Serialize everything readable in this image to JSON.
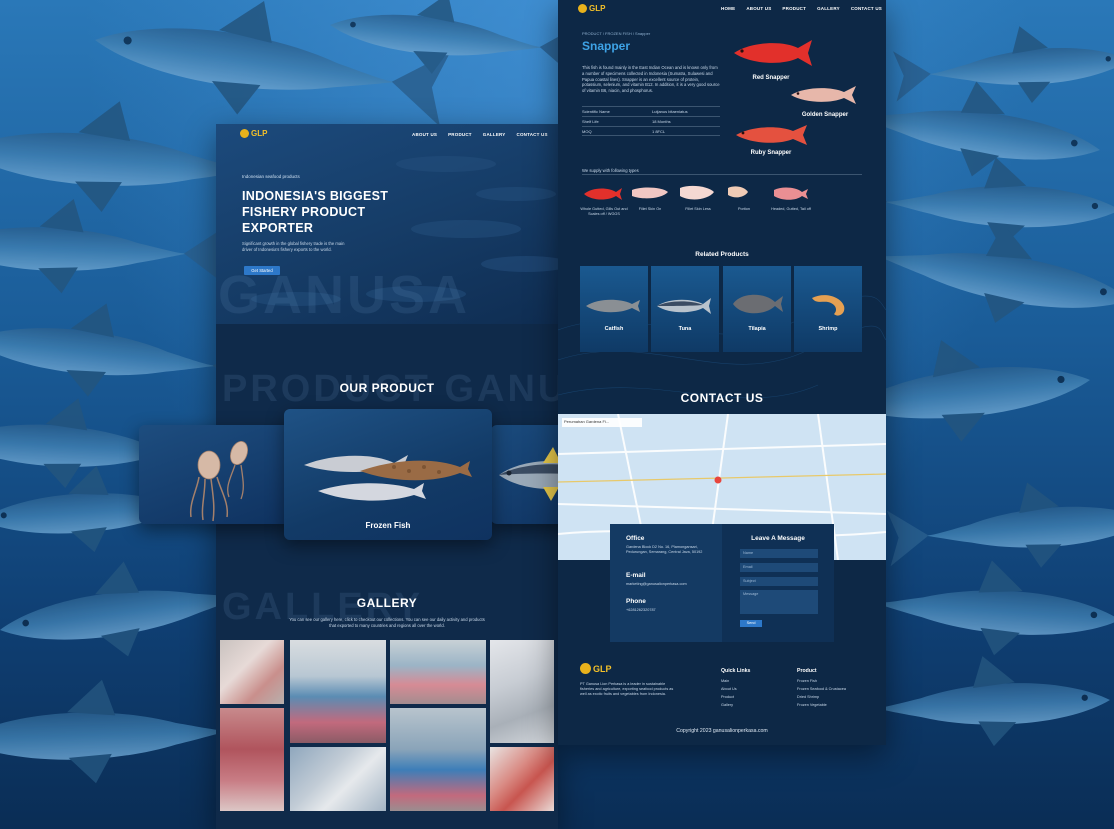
{
  "left_page": {
    "logo_text": "GLP",
    "nav": [
      "ABOUT US",
      "PRODUCT",
      "GALLERY",
      "CONTACT US"
    ],
    "hero_small": "Indonesian seafood products",
    "hero_title": "INDONESIA'S BIGGEST FISHERY PRODUCT EXPORTER",
    "hero_desc": "Significant growth in the global fishery trade is the main driver of Indonesia's fishery exports to the world.",
    "hero_button": "Get Started",
    "hero_watermark": "GANUSA",
    "product_watermark": "PRODUCT GANUSA",
    "our_product_title": "OUR PRODUCT",
    "product_card_label": "Frozen Fish",
    "gallery_watermark": "GALLERY",
    "gallery_title": "GALLERY",
    "gallery_desc": "You can see our gallery here, click to checkout our collections. You can see our daily activity and products that exported to many countries and regions all over the world."
  },
  "right_page": {
    "logo_text": "GLP",
    "nav": [
      "HOME",
      "ABOUT US",
      "PRODUCT",
      "GALLERY",
      "CONTACT US"
    ],
    "breadcrumb": "PRODUCT / FROZEN FISH / Snapper",
    "title": "Snapper",
    "description": "This fish is found mainly in the East Indian Ocean and is known only from a number of specimens collected in Indonesia (Sumatra, Sulawesi and Papua coastal lines). Snapper is an excellent source of protein, potassium, selenium, and vitamin B12. In addition, it is a very good source of vitamin B6, niacin, and phosphorus.",
    "specs": [
      {
        "label": "Scientific Name",
        "value": "Lutjanus bitaeniatus"
      },
      {
        "label": "Shelf Life",
        "value": "18 Months"
      },
      {
        "label": "MOQ",
        "value": "1 8FCL"
      }
    ],
    "varieties": [
      "Red Snapper",
      "Golden Snapper",
      "Ruby Snapper"
    ],
    "types_label": "We supply with following types",
    "types": [
      "Whole Gutted, Gills Out and Scales off / WGGS",
      "Fillet Skin On",
      "Fillet Skin Less",
      "Portion",
      "Headed, Gutted, Tail off"
    ],
    "related_title": "Related Products",
    "related": [
      "Catfish",
      "Tuna",
      "Tilapia",
      "Shrimp"
    ],
    "contact_title": "CONTACT US",
    "office_heading": "Office",
    "office_text": "Gardena Block D2 No. 16, Plamongansari, Pedurungan, Semarang, Central Java, 50192",
    "email_heading": "E-mail",
    "email_text": "marketing@ganusalionperkasa.com",
    "phone_heading": "Phone",
    "phone_text": "+6281262320787",
    "message_title": "Leave A Message",
    "fields": [
      "Name",
      "Email",
      "Subject",
      "Message"
    ],
    "send_button": "Send",
    "map_label": "Perumahan Gardena Fi...",
    "footer_logo": "GLP",
    "footer_desc": "PT Ganusa Lion Perkasa is a leader in sustainable fisheries and agriculture, exporting seafood products as well as exotic fruits and vegetables from Indonesia.",
    "quick_links_title": "Quick Links",
    "quick_links": [
      "Main",
      "About Us",
      "Product",
      "Gallery"
    ],
    "product_col_title": "Product",
    "product_col_items": [
      "Frozen Fish",
      "Frozen Seafood & Crustacea",
      "Dried Shrimp",
      "Frozen Vegetable"
    ],
    "copyright": "Copyright 2023 ganusalionperkasa.com"
  },
  "colors": {
    "accent_blue": "#3ea3e6",
    "logo_gold": "#f3c12a",
    "button_blue": "#2d78c9",
    "snapper_red": "#e03a35"
  }
}
